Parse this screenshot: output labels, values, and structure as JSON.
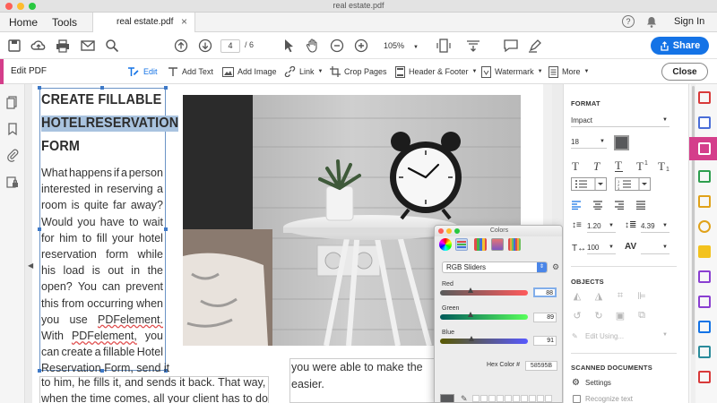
{
  "window": {
    "title": "real estate.pdf"
  },
  "tabs": {
    "home": "Home",
    "tools": "Tools",
    "file": "real estate.pdf",
    "close_glyph": "×",
    "help_glyph": "?",
    "signin": "Sign In"
  },
  "toolbar": {
    "page_current": "4",
    "page_sep": "/",
    "page_total": "6",
    "zoom": "105%",
    "share": "Share"
  },
  "editbar": {
    "title": "Edit PDF",
    "tools": [
      {
        "label": "Edit",
        "icon": "edit-text-icon"
      },
      {
        "label": "Add Text",
        "icon": "add-text-icon"
      },
      {
        "label": "Add Image",
        "icon": "add-image-icon"
      },
      {
        "label": "Link",
        "icon": "link-icon"
      },
      {
        "label": "Crop Pages",
        "icon": "crop-icon"
      },
      {
        "label": "Header & Footer",
        "icon": "header-footer-icon"
      },
      {
        "label": "Watermark",
        "icon": "watermark-icon"
      },
      {
        "label": "More",
        "icon": "more-icon"
      }
    ],
    "close": "Close"
  },
  "document": {
    "heading": [
      "CREATE FILLABLE",
      "HOTELRESERVATION",
      "FORM"
    ],
    "body_lines": [
      "What happens if a person",
      "interested in reserving a",
      "room is quite far away?",
      "Would you have to wait",
      "for him to fill your hotel",
      "reservation form while",
      "his load is out in the",
      "open? You can prevent",
      "this from occurring when",
      "you use PDFelement.",
      "With PDFelement, you",
      "can create a fillable Hotel",
      "Reservation Form, send it"
    ],
    "bottom_lines": [
      "to him, he fills it, and sends it back. That way,",
      "when the time comes, all your client has to do"
    ],
    "right_col_lines": [
      "you were able to make the",
      "easier."
    ]
  },
  "colors_panel": {
    "title": "Colors",
    "mode": "RGB Sliders",
    "red_label": "Red",
    "red": "88",
    "green_label": "Green",
    "green": "89",
    "blue_label": "Blue",
    "blue": "91",
    "hex_label": "Hex Color #",
    "hex": "58595B",
    "levels": {
      "red": 0.345,
      "green": 0.349,
      "blue": 0.357
    },
    "current_color": "#58595B"
  },
  "format_panel": {
    "format_header": "FORMAT",
    "font": "Impact",
    "size": "18",
    "text_color": "#58595B",
    "line_spacing": "1.20",
    "para_spacing": "4.39",
    "scale": "100",
    "objects_header": "OBJECTS",
    "edit_using": "Edit Using...",
    "scanned_header": "SCANNED DOCUMENTS",
    "settings": "Settings",
    "recognize": "Recognize text"
  },
  "colors": {
    "accent": "#1473e6",
    "edit_accent": "#d43e8b",
    "heading_highlight": "#a9c3df"
  }
}
